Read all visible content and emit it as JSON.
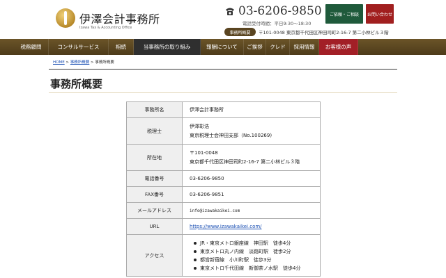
{
  "header": {
    "logo_jp": "伊澤会計事務所",
    "logo_en": "Izawa Tax & Accounting Office",
    "phone": "03-6206-9850",
    "hours": "電話受付時間：平日9:30〜18:30",
    "btn_consult": "ご依頼・ご相談",
    "btn_inquiry": "お問い合わせ",
    "addr_badge": "事務所概要",
    "address": "〒101-0048 東京都千代田区神田司町2-16-7 第二小林ビル３階"
  },
  "nav": [
    {
      "label": "税務顧問",
      "w": 46,
      "style": ""
    },
    {
      "label": "コンサルサービス",
      "w": 86,
      "style": ""
    },
    {
      "label": "相続",
      "w": 36,
      "style": ""
    },
    {
      "label": "当事務所の取り組み",
      "w": 96,
      "style": "dark"
    },
    {
      "label": "報酬について",
      "w": 62,
      "style": ""
    },
    {
      "label": "ご挨拶",
      "w": 32,
      "style": ""
    },
    {
      "label": "クレド",
      "w": 34,
      "style": ""
    },
    {
      "label": "採用情報",
      "w": 42,
      "style": ""
    },
    {
      "label": "お客様の声",
      "w": 56,
      "style": "accent"
    }
  ],
  "breadcrumb": {
    "home": "HOME",
    "parent": "事務所概要",
    "current": "事務所概要",
    "sep": " > "
  },
  "page_title": "事務所概要",
  "table": {
    "rows": [
      {
        "label": "事務所名",
        "lines": [
          "伊澤会計事務所"
        ]
      },
      {
        "label": "税理士",
        "lines": [
          "伊澤彰浩",
          "東京税理士会神田支部（No.100269)"
        ]
      },
      {
        "label": "所在地",
        "lines": [
          "〒101-0048",
          "東京都千代田区神田司町2-16-7 第二小林ビル３階"
        ]
      },
      {
        "label": "電話番号",
        "lines": [
          "03-6206-9850"
        ]
      },
      {
        "label": "FAX番号",
        "lines": [
          "03-6206-9851"
        ]
      },
      {
        "label": "メールアドレス",
        "lines": [
          "info@izawakaikei.com"
        ]
      },
      {
        "label": "URL",
        "lines": [
          "https://www.izawakaikei.com/"
        ]
      },
      {
        "label": "アクセス",
        "lines": [
          "JR・東京メトロ銀座線　神田駅　徒歩4分",
          "東京メトロ丸ノ内線　淡路町駅　徒歩2分",
          "都営新宿線　小川町駅　徒歩3分",
          "東京メトロ千代田線　新御茶ノ水駅　徒歩4分"
        ]
      }
    ]
  },
  "colors": {
    "nav_bg": "#5c4720",
    "consult": "#1f5a3b",
    "inquiry": "#a11f1f",
    "link": "#1a4fb3"
  }
}
